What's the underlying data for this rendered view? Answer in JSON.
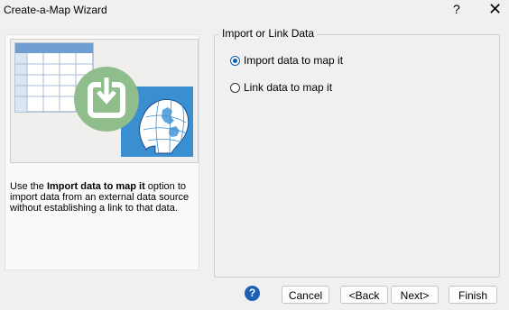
{
  "window": {
    "title": "Create-a-Map Wizard",
    "help_glyph": "?",
    "close_glyph": "✕"
  },
  "left_panel": {
    "desc_pre": "Use the ",
    "desc_bold": "Import data to map it",
    "desc_post": " option to import data from an external data source without establishing a link to that data."
  },
  "group": {
    "label": "Import or Link Data",
    "options": [
      {
        "label": "Import data to map it",
        "selected": true
      },
      {
        "label": "Link data to map it",
        "selected": false
      }
    ]
  },
  "footer": {
    "help_glyph": "?",
    "cancel": "Cancel",
    "back": "<Back",
    "next": "Next>",
    "finish": "Finish"
  },
  "colors": {
    "accent": "#0a5fb4",
    "download_circle": "#8fbd8c",
    "globe_bg": "#3a8fd1",
    "table_header": "#6f9fd0"
  }
}
